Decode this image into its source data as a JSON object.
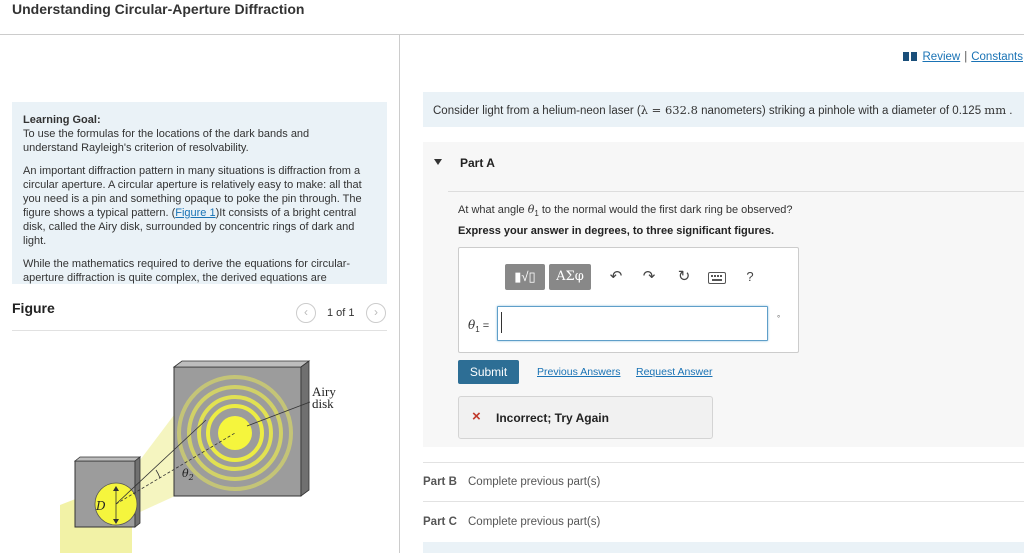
{
  "page": {
    "title": "Understanding Circular-Aperture Diffraction"
  },
  "goal": {
    "heading": "Learning Goal:",
    "line1": "To use the formulas for the locations of the dark bands and",
    "line2": "understand Rayleigh's criterion of resolvability.",
    "p1_l1": "An important diffraction pattern in many situations is diffraction from a",
    "p1_l2": "circular aperture. A circular aperture is relatively easy to make: all that",
    "p1_l3": "you need is a pin and something opaque to poke the pin through. The",
    "p1_l4_pre": "figure shows a typical pattern. (",
    "p1_l4_link": "Figure 1",
    "p1_l4_post": ")It consists of a bright central",
    "p1_l5": "disk, called the Airy disk, surrounded by concentric rings of dark and",
    "p1_l6": "light.",
    "p2_l1": "While the mathematics required to derive the equations for circular-",
    "p2_l2": "aperture diffraction is quite complex, the derived equations are"
  },
  "figure": {
    "label": "Figure",
    "count": "1 of 1",
    "prev_icon": "chevron-left-icon",
    "next_icon": "chevron-right-icon",
    "airy_label_1": "Airy",
    "airy_label_2": "disk",
    "theta_label": "θ",
    "theta_sub": "2",
    "d_label": "D"
  },
  "header_links": {
    "review": "Review",
    "separator": "|",
    "constants": "Constants"
  },
  "problem": {
    "pre": "Consider light from a helium-neon laser (",
    "lambda": "λ = 632.8",
    "mid": " nanometers) striking a pinhole with a diameter of 0.125 ",
    "unit": "mm",
    "post": " ."
  },
  "part_a": {
    "title": "Part A",
    "question_pre": "At what angle ",
    "question_var": "θ",
    "question_sub": "1",
    "question_post": " to the normal would the first dark ring be observed?",
    "instruction": "Express your answer in degrees, to three significant figures.",
    "toolbar": {
      "templates": "▮√▯",
      "greek": "ΑΣφ",
      "undo": "↶",
      "redo": "↷",
      "reset": "↻",
      "keyboard_icon": "keyboard-icon",
      "help": "?"
    },
    "answer_var": "θ",
    "answer_sub": "1",
    "answer_eq": " =",
    "answer_value": "",
    "unit": "°",
    "submit": "Submit",
    "previous_answers": "Previous Answers",
    "request_answer": "Request Answer",
    "feedback": "Incorrect; Try Again",
    "feedback_icon": "×"
  },
  "part_b": {
    "title": "Part B",
    "status": "Complete previous part(s)"
  },
  "part_c": {
    "title": "Part C",
    "status": "Complete previous part(s)"
  },
  "colors": {
    "accent": "#1a73b5",
    "submit_bg": "#2d6e95",
    "info_bg": "#eaf2f7",
    "error": "#c0392b",
    "airy_disk": "#f5f53d"
  }
}
